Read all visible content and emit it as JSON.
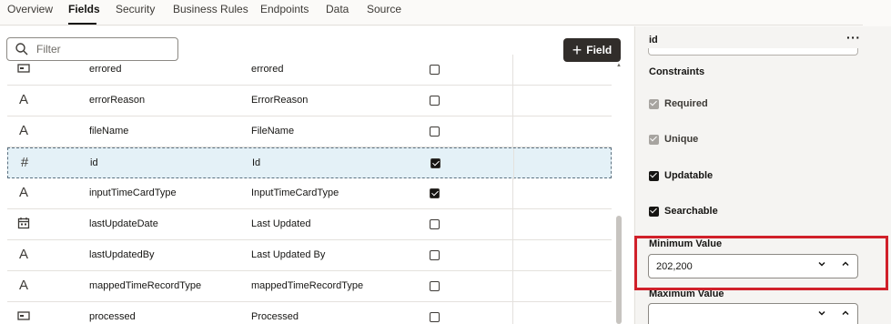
{
  "tabs": [
    {
      "label": "Overview"
    },
    {
      "label": "Fields"
    },
    {
      "label": "Security"
    },
    {
      "label": "Business Rules"
    },
    {
      "label": "Endpoints"
    },
    {
      "label": "Data"
    },
    {
      "label": "Source"
    }
  ],
  "active_tab": "Fields",
  "filter": {
    "placeholder": "Filter",
    "value": ""
  },
  "add_button": {
    "label": "Field"
  },
  "rows": [
    {
      "icon": "boolean-icon",
      "name": "errored",
      "label": "errored",
      "checked": false,
      "selected": false
    },
    {
      "icon": "text-type-icon",
      "name": "errorReason",
      "label": "ErrorReason",
      "checked": false,
      "selected": false
    },
    {
      "icon": "text-type-icon",
      "name": "fileName",
      "label": "FileName",
      "checked": false,
      "selected": false
    },
    {
      "icon": "number-type-icon",
      "name": "id",
      "label": "Id",
      "checked": true,
      "selected": true
    },
    {
      "icon": "text-type-icon",
      "name": "inputTimeCardType",
      "label": "InputTimeCardType",
      "checked": true,
      "selected": false
    },
    {
      "icon": "datetime-type-icon",
      "name": "lastUpdateDate",
      "label": "Last Updated",
      "checked": false,
      "selected": false
    },
    {
      "icon": "text-type-icon",
      "name": "lastUpdatedBy",
      "label": "Last Updated By",
      "checked": false,
      "selected": false
    },
    {
      "icon": "text-type-icon",
      "name": "mappedTimeRecordType",
      "label": "mappedTimeRecordType",
      "checked": false,
      "selected": false
    },
    {
      "icon": "boolean-icon",
      "name": "processed",
      "label": "Processed",
      "checked": false,
      "selected": false
    }
  ],
  "properties": {
    "title": "id",
    "more_label": "···",
    "constraints_title": "Constraints",
    "constraints": [
      {
        "label": "Required",
        "checked": true,
        "disabled": true
      },
      {
        "label": "Unique",
        "checked": true,
        "disabled": true
      },
      {
        "label": "Updatable",
        "checked": true,
        "disabled": false
      },
      {
        "label": "Searchable",
        "checked": true,
        "disabled": false
      }
    ],
    "min_value": {
      "label": "Minimum Value",
      "value": "202,200"
    },
    "max_value": {
      "label": "Maximum Value",
      "value": ""
    }
  },
  "colors": {
    "accent": "#161513",
    "selected_row": "#e4f1f7",
    "highlight": "#d0202a",
    "button": "#312d2a"
  }
}
